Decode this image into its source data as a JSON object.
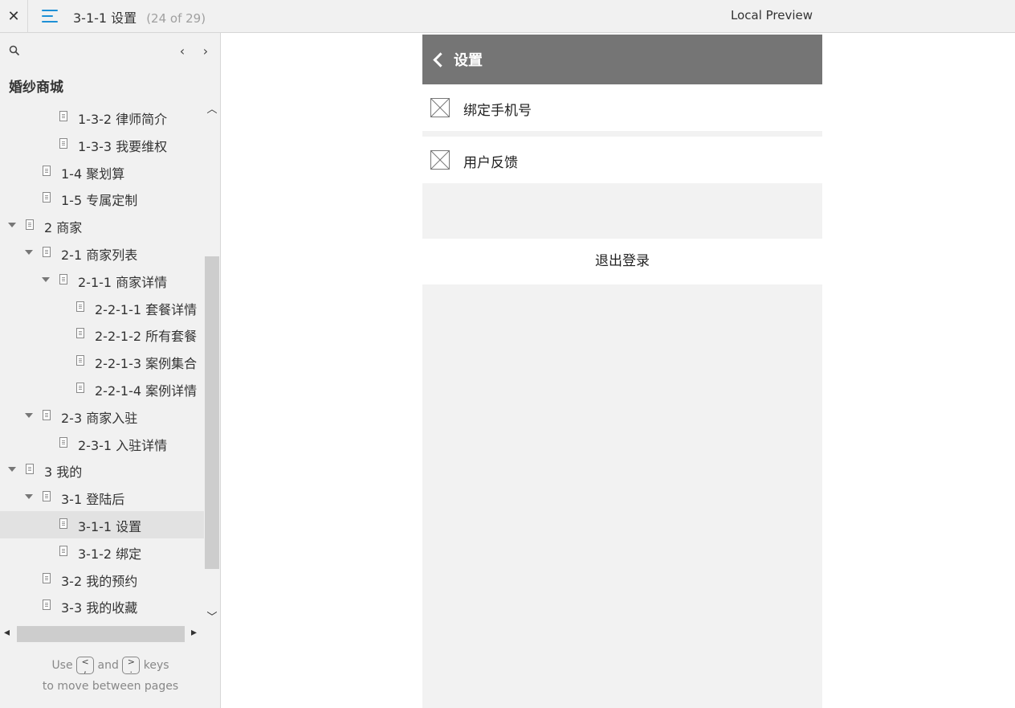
{
  "topbar": {
    "close_glyph": "✕",
    "page_title": "3-1-1 设置",
    "page_counter": "(24 of 29)",
    "preview_label": "Local Preview"
  },
  "sidebar": {
    "project_title": "婚纱商城",
    "prev_glyph": "‹",
    "next_glyph": "›",
    "tree": [
      {
        "label": "1-3-2 律师简介",
        "level": 3,
        "expanded": null
      },
      {
        "label": "1-3-3 我要维权",
        "level": 3,
        "expanded": null
      },
      {
        "label": "1-4 聚划算",
        "level": 2,
        "expanded": null
      },
      {
        "label": "1-5 专属定制",
        "level": 2,
        "expanded": null
      },
      {
        "label": "2 商家",
        "level": 1,
        "expanded": true
      },
      {
        "label": "2-1 商家列表",
        "level": 2,
        "expanded": true
      },
      {
        "label": "2-1-1 商家详情",
        "level": 3,
        "expanded": true
      },
      {
        "label": "2-2-1-1 套餐详情",
        "level": 4,
        "expanded": null
      },
      {
        "label": "2-2-1-2 所有套餐",
        "level": 4,
        "expanded": null
      },
      {
        "label": "2-2-1-3 案例集合",
        "level": 4,
        "expanded": null
      },
      {
        "label": "2-2-1-4 案例详情",
        "level": 4,
        "expanded": null
      },
      {
        "label": "2-3 商家入驻",
        "level": 2,
        "expanded": true
      },
      {
        "label": "2-3-1 入驻详情",
        "level": 3,
        "expanded": null
      },
      {
        "label": "3 我的",
        "level": 1,
        "expanded": true
      },
      {
        "label": "3-1 登陆后",
        "level": 2,
        "expanded": true
      },
      {
        "label": "3-1-1 设置",
        "level": 3,
        "expanded": null,
        "selected": true
      },
      {
        "label": "3-1-2 绑定",
        "level": 3,
        "expanded": null
      },
      {
        "label": "3-2 我的预约",
        "level": 2,
        "expanded": null
      },
      {
        "label": "3-3 我的收藏",
        "level": 2,
        "expanded": null
      }
    ],
    "hint": {
      "use": "Use",
      "and": "and",
      "keys": "keys",
      "line2": "to move between pages",
      "prev_key": "<\n,",
      "next_key": ">\n."
    }
  },
  "phone": {
    "header_title": "设置",
    "rows": [
      {
        "label": "绑定手机号"
      },
      {
        "label": "用户反馈"
      }
    ],
    "logout_label": "退出登录"
  },
  "colors": {
    "accent": "#1e90d6",
    "header_bg": "#757575",
    "sidebar_bg": "#f1f1f1",
    "selected_row": "#e2e2e2"
  }
}
